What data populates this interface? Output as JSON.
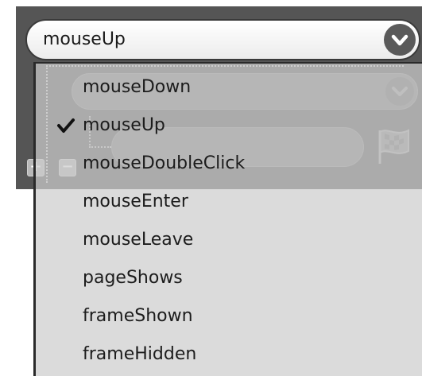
{
  "combo": {
    "selected_value": "mouseUp"
  },
  "menu": {
    "items": [
      {
        "label": "mouseDown",
        "checked": false
      },
      {
        "label": "mouseUp",
        "checked": true
      },
      {
        "label": "mouseDoubleClick",
        "checked": false
      },
      {
        "label": "mouseEnter",
        "checked": false
      },
      {
        "label": "mouseLeave",
        "checked": false
      },
      {
        "label": "pageShows",
        "checked": false
      },
      {
        "label": "frameShown",
        "checked": false
      },
      {
        "label": "frameHidden",
        "checked": false
      }
    ]
  },
  "icons": {
    "combo_arrow": "chevron-down-icon",
    "check": "checkmark-icon",
    "add": "plus-icon",
    "remove": "minus-icon",
    "flag": "checkered-flag-icon"
  },
  "colors": {
    "panel_background": "#555555",
    "menu_background": "#cdcdcd",
    "combo_arrow_background": "#5a5a5a"
  }
}
